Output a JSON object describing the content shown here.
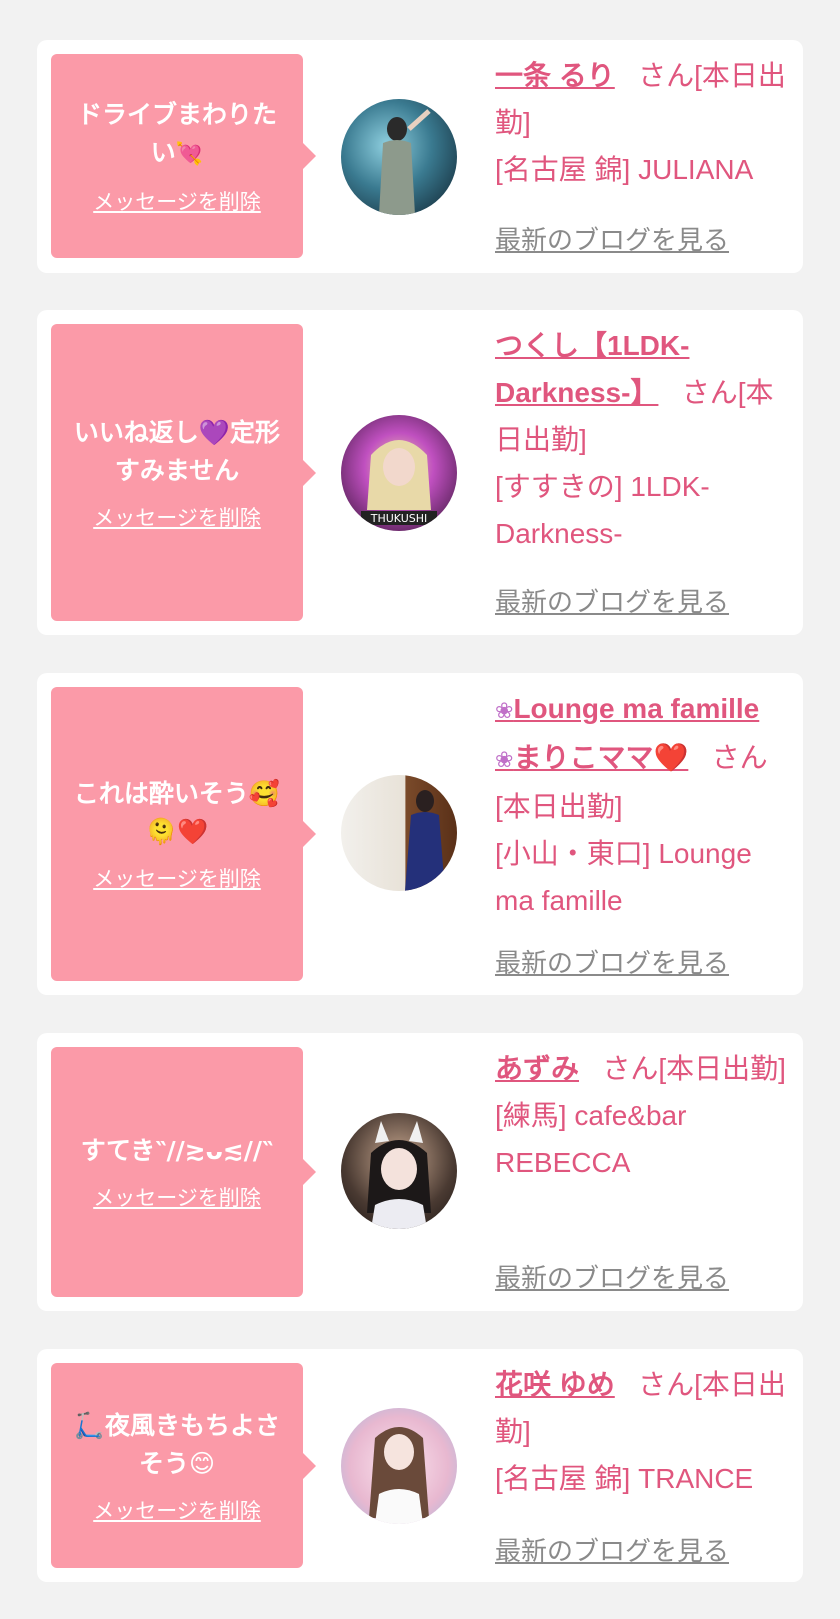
{
  "entries": [
    {
      "message_line1": "ドライブまわりた",
      "message_line2": "い",
      "message_emoji": "💘",
      "delete_label": "メッセージを削除",
      "name": "一条 るり",
      "suffix": "さん[本日出勤]",
      "shop": "[名古屋 錦] JULIANA",
      "blog_label": "最新のブログを見る"
    },
    {
      "message_line1": "いいね返し💜定形",
      "message_line2": "すみません",
      "delete_label": "メッセージを削除",
      "name": "つくし【1LDK-Darkness-】",
      "suffix": "さん[本日出勤]",
      "shop": "[すすきの] 1LDK-Darkness-",
      "blog_label": "最新のブログを見る"
    },
    {
      "message_line1": "これは酔いそう🥰",
      "message_line2": "🫠❤️",
      "delete_label": "メッセージを削除",
      "name_line1": "Lounge ma famille",
      "name_line2": "まりこママ❤️",
      "suffix": "さん[本日出勤]",
      "shop": "[小山・東口] Lounge ma famille",
      "blog_label": "最新のブログを見る"
    },
    {
      "message_line1": "すてき˘ ͈ᵕ˘ ͈",
      "message_display": "すてき‶//≳ᴗ≲//‶",
      "delete_label": "メッセージを削除",
      "name": "あずみ",
      "suffix": "さん[本日出勤]",
      "shop": "[練馬] cafe&bar REBECCA",
      "blog_label": "最新のブログを見る"
    },
    {
      "message_line1": "🛴夜風きもちよさ",
      "message_line2": "そう😊",
      "delete_label": "メッセージを削除",
      "name": "花咲 ゆめ",
      "suffix": "さん[本日出勤]",
      "shop": "[名古屋 錦] TRANCE",
      "blog_label": "最新のブログを見る"
    }
  ],
  "icons": {
    "flower": "hibiscus-icon"
  },
  "colors": {
    "accent": "#e0567e",
    "bubble": "#fb9aa8",
    "link_gray": "#8a8a8a",
    "background": "#f2f2f2"
  }
}
